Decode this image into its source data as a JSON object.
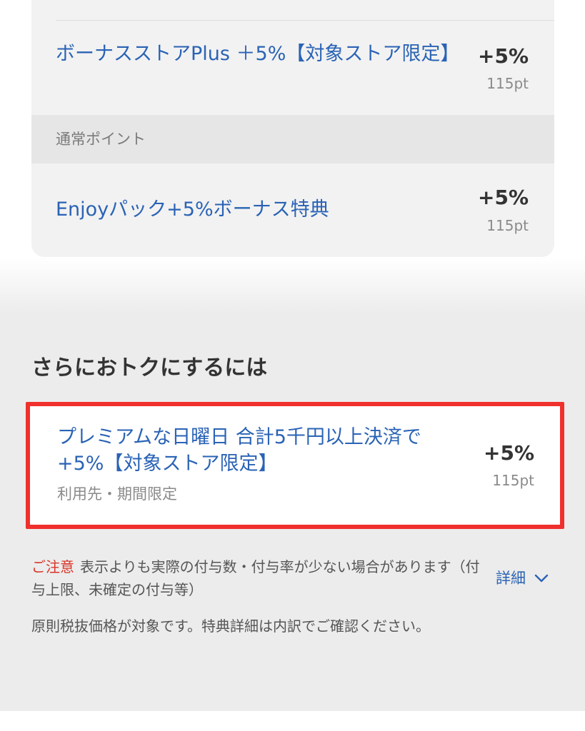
{
  "points_list": {
    "items": [
      {
        "title": "ボーナスストアPlus ＋5%【対象ストア限定】",
        "rate": "+5%",
        "points": "115pt"
      }
    ],
    "section_label": "通常ポイント",
    "regular_items": [
      {
        "title": "Enjoyパック+5%ボーナス特典",
        "rate": "+5%",
        "points": "115pt"
      }
    ]
  },
  "more_deals": {
    "heading": "さらにおトクにするには",
    "offer": {
      "title": "プレミアムな日曜日 合計5千円以上決済で+5%【対象ストア限定】",
      "subtitle": "利用先・期間限定",
      "rate": "+5%",
      "points": "115pt"
    }
  },
  "notice": {
    "label": "ご注意",
    "text": "表示よりも実際の付与数・付与率が少ない場合があります（付与上限、未確定の付与等）",
    "detail_label": "詳細",
    "footnote": "原則税抜価格が対象です。特典詳細は内訳でご確認ください。"
  },
  "colors": {
    "link_blue": "#2a63b5",
    "highlight_red": "#f0302c",
    "caution_red": "#d9352a"
  }
}
